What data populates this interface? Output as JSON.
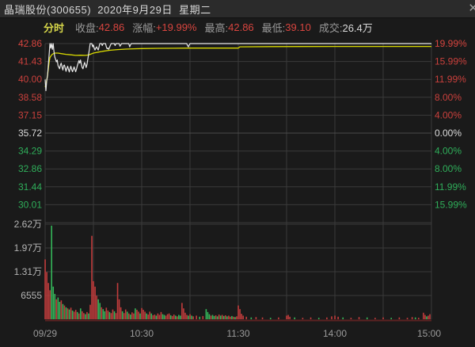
{
  "window": {
    "title": "晶瑞股份(300655)  2020年9月29日  星期二",
    "close_icon": "✕"
  },
  "info_bar": {
    "mode_label": "分时",
    "fields": [
      {
        "label": "收盘:",
        "value": "42.86",
        "value_color": "#d8453f"
      },
      {
        "label": "涨幅:",
        "value": "+19.99%",
        "value_color": "#d8453f"
      },
      {
        "label": "最高:",
        "value": "42.86",
        "value_color": "#d8453f"
      },
      {
        "label": "最低:",
        "value": "39.10",
        "value_color": "#d8453f"
      },
      {
        "label": "成交:",
        "value": "26.4万",
        "value_color": "#d9d9d9"
      }
    ]
  },
  "chart_data": {
    "type": "line",
    "title": "晶瑞股份(300655) 分时走势 2020-09-29",
    "x_axis": {
      "labels": [
        "09/29",
        "10:30",
        "11:30",
        "14:00",
        "15:00"
      ],
      "total_minutes": 240
    },
    "price_axis": {
      "ref_price": 35.72,
      "top_price": 42.86,
      "bottom_price": 28.58,
      "left_labels": [
        {
          "text": "42.86",
          "color": "#d8453f"
        },
        {
          "text": "41.43",
          "color": "#c9403c"
        },
        {
          "text": "40.00",
          "color": "#c9403c"
        },
        {
          "text": "38.58",
          "color": "#c9403c"
        },
        {
          "text": "37.15",
          "color": "#c9403c"
        },
        {
          "text": "35.72",
          "color": "#dcdcdc"
        },
        {
          "text": "34.29",
          "color": "#2fae5a"
        },
        {
          "text": "32.86",
          "color": "#2fae5a"
        },
        {
          "text": "31.44",
          "color": "#2fae5a"
        },
        {
          "text": "30.01",
          "color": "#2fae5a"
        }
      ],
      "right_labels": [
        {
          "text": "19.99%",
          "color": "#d8453f"
        },
        {
          "text": "15.99%",
          "color": "#c9403c"
        },
        {
          "text": "11.99%",
          "color": "#c9403c"
        },
        {
          "text": "8.00%",
          "color": "#c9403c"
        },
        {
          "text": "4.00%",
          "color": "#c9403c"
        },
        {
          "text": "0.00%",
          "color": "#dcdcdc"
        },
        {
          "text": "4.00%",
          "color": "#2fae5a"
        },
        {
          "text": "8.00%",
          "color": "#2fae5a"
        },
        {
          "text": "11.99%",
          "color": "#2fae5a"
        },
        {
          "text": "15.99%",
          "color": "#2fae5a"
        }
      ]
    },
    "volume_axis": {
      "labels": [
        "2.62万",
        "1.97万",
        "1.31万",
        "6555"
      ],
      "max_wan": 2.62,
      "label_color": "#b5b5b5"
    },
    "colors": {
      "price_line": "#eaeaea",
      "avg_line": "#d8d800",
      "vol_up": "#c23c3c",
      "vol_down": "#35b559",
      "grid": "#3a3a3a",
      "grid_zero": "#4a4a4a",
      "baseline": "#5c2222",
      "time_label": "#9a9a9a"
    },
    "series": [
      {
        "name": "price",
        "points": [
          [
            0,
            40.0
          ],
          [
            0.5,
            39.1
          ],
          [
            1,
            39.9
          ],
          [
            1.5,
            40.3
          ],
          [
            2,
            41.2
          ],
          [
            2.5,
            42.0
          ],
          [
            3,
            42.86
          ],
          [
            3.5,
            42.5
          ],
          [
            4,
            42.86
          ],
          [
            4.5,
            42.4
          ],
          [
            5,
            42.86
          ],
          [
            5.5,
            42.2
          ],
          [
            6,
            41.8
          ],
          [
            7,
            41.4
          ],
          [
            7.5,
            41.55
          ],
          [
            8,
            41.1
          ],
          [
            9,
            40.85
          ],
          [
            9.5,
            41.15
          ],
          [
            10,
            41.3
          ],
          [
            10.5,
            41.0
          ],
          [
            11,
            40.75
          ],
          [
            11.5,
            41.1
          ],
          [
            12,
            41.15
          ],
          [
            12.5,
            40.9
          ],
          [
            13,
            40.65
          ],
          [
            13.5,
            40.9
          ],
          [
            14,
            41.05
          ],
          [
            14.5,
            40.8
          ],
          [
            15,
            40.6
          ],
          [
            15.5,
            40.85
          ],
          [
            16,
            41.05
          ],
          [
            16.5,
            40.8
          ],
          [
            17,
            40.62
          ],
          [
            17.5,
            40.8
          ],
          [
            18,
            41.0
          ],
          [
            18.5,
            40.8
          ],
          [
            19,
            40.62
          ],
          [
            19.5,
            40.85
          ],
          [
            20,
            41.1
          ],
          [
            20.5,
            41.3
          ],
          [
            21,
            41.5
          ],
          [
            21.5,
            41.3
          ],
          [
            22,
            41.55
          ],
          [
            22.5,
            41.2
          ],
          [
            23,
            40.95
          ],
          [
            23.5,
            40.85
          ],
          [
            24,
            41.1
          ],
          [
            24.5,
            41.35
          ],
          [
            25,
            41.2
          ],
          [
            25.5,
            40.95
          ],
          [
            26,
            41.2
          ],
          [
            26.5,
            41.6
          ],
          [
            27,
            42.0
          ],
          [
            27.5,
            42.4
          ],
          [
            28,
            42.86
          ],
          [
            29,
            42.86
          ],
          [
            29.5,
            42.6
          ],
          [
            30,
            42.75
          ],
          [
            30.5,
            42.5
          ],
          [
            31,
            42.35
          ],
          [
            31.5,
            42.5
          ],
          [
            32,
            42.6
          ],
          [
            32.5,
            42.45
          ],
          [
            33,
            42.35
          ],
          [
            33.5,
            42.6
          ],
          [
            34,
            42.86
          ],
          [
            35,
            42.86
          ],
          [
            35.5,
            42.7
          ],
          [
            36,
            42.86
          ],
          [
            37.5,
            42.86
          ],
          [
            38,
            42.6
          ],
          [
            38.5,
            42.45
          ],
          [
            39,
            42.5
          ],
          [
            39.5,
            42.4
          ],
          [
            40,
            42.55
          ],
          [
            40.5,
            42.7
          ],
          [
            41,
            42.86
          ],
          [
            43,
            42.86
          ],
          [
            43.5,
            42.7
          ],
          [
            44,
            42.86
          ],
          [
            46,
            42.86
          ],
          [
            46.5,
            42.65
          ],
          [
            47,
            42.75
          ],
          [
            47.5,
            42.86
          ],
          [
            52,
            42.86
          ],
          [
            52.5,
            42.6
          ],
          [
            53,
            42.75
          ],
          [
            53.5,
            42.86
          ],
          [
            88,
            42.86
          ],
          [
            88.5,
            42.7
          ],
          [
            89,
            42.6
          ],
          [
            89.5,
            42.75
          ],
          [
            90,
            42.86
          ],
          [
            240,
            42.86
          ]
        ]
      },
      {
        "name": "average",
        "points": [
          [
            0,
            39.4
          ],
          [
            0.5,
            39.6
          ],
          [
            1,
            39.9
          ],
          [
            1.5,
            40.3
          ],
          [
            2,
            40.9
          ],
          [
            2.5,
            41.4
          ],
          [
            3,
            41.75
          ],
          [
            4,
            41.95
          ],
          [
            5,
            42.05
          ],
          [
            6,
            42.1
          ],
          [
            8,
            42.1
          ],
          [
            10,
            42.06
          ],
          [
            13,
            42.0
          ],
          [
            16,
            41.96
          ],
          [
            19,
            41.92
          ],
          [
            22,
            41.93
          ],
          [
            25,
            41.92
          ],
          [
            27,
            41.95
          ],
          [
            28,
            42.0
          ],
          [
            30,
            42.1
          ],
          [
            33,
            42.18
          ],
          [
            36,
            42.25
          ],
          [
            40,
            42.32
          ],
          [
            45,
            42.38
          ],
          [
            50,
            42.42
          ],
          [
            55,
            42.44
          ],
          [
            60,
            42.46
          ],
          [
            70,
            42.48
          ],
          [
            80,
            42.49
          ],
          [
            90,
            42.5
          ],
          [
            110,
            42.5
          ],
          [
            120,
            42.5
          ],
          [
            121,
            42.6
          ],
          [
            140,
            42.62
          ],
          [
            180,
            42.63
          ],
          [
            240,
            42.63
          ]
        ]
      }
    ],
    "volume_bars": [
      [
        0,
        1.65,
        "r"
      ],
      [
        1,
        1.3,
        "r"
      ],
      [
        2,
        1.0,
        "r"
      ],
      [
        3,
        0.8,
        "r"
      ],
      [
        4,
        2.58,
        "g"
      ],
      [
        5,
        0.9,
        "g"
      ],
      [
        6,
        0.7,
        "g"
      ],
      [
        7,
        0.55,
        "r"
      ],
      [
        8,
        0.6,
        "g"
      ],
      [
        9,
        0.48,
        "g"
      ],
      [
        10,
        0.52,
        "r"
      ],
      [
        11,
        0.42,
        "g"
      ],
      [
        12,
        0.38,
        "r"
      ],
      [
        13,
        0.33,
        "g"
      ],
      [
        14,
        0.3,
        "r"
      ],
      [
        15,
        0.27,
        "g"
      ],
      [
        16,
        0.32,
        "r"
      ],
      [
        17,
        0.24,
        "g"
      ],
      [
        18,
        0.21,
        "r"
      ],
      [
        19,
        0.26,
        "r"
      ],
      [
        20,
        0.2,
        "g"
      ],
      [
        21,
        0.16,
        "r"
      ],
      [
        22,
        0.3,
        "g"
      ],
      [
        23,
        0.22,
        "r"
      ],
      [
        24,
        0.17,
        "r"
      ],
      [
        25,
        0.14,
        "g"
      ],
      [
        26,
        0.2,
        "r"
      ],
      [
        27,
        0.16,
        "g"
      ],
      [
        28,
        0.4,
        "r"
      ],
      [
        29,
        2.3,
        "r"
      ],
      [
        30,
        1.05,
        "r"
      ],
      [
        31,
        0.9,
        "r"
      ],
      [
        32,
        0.65,
        "r"
      ],
      [
        33,
        0.55,
        "g"
      ],
      [
        34,
        0.45,
        "g"
      ],
      [
        35,
        0.33,
        "r"
      ],
      [
        36,
        0.28,
        "g"
      ],
      [
        37,
        0.22,
        "g"
      ],
      [
        38,
        0.32,
        "r"
      ],
      [
        39,
        0.24,
        "r"
      ],
      [
        40,
        0.2,
        "g"
      ],
      [
        41,
        0.17,
        "r"
      ],
      [
        42,
        0.27,
        "r"
      ],
      [
        43,
        0.22,
        "g"
      ],
      [
        44,
        0.17,
        "r"
      ],
      [
        45,
        1.0,
        "r"
      ],
      [
        46,
        0.55,
        "r"
      ],
      [
        47,
        0.33,
        "r"
      ],
      [
        48,
        0.22,
        "g"
      ],
      [
        49,
        0.17,
        "r"
      ],
      [
        50,
        0.27,
        "r"
      ],
      [
        51,
        0.21,
        "g"
      ],
      [
        52,
        0.16,
        "r"
      ],
      [
        53,
        0.13,
        "g"
      ],
      [
        54,
        0.19,
        "r"
      ],
      [
        55,
        0.16,
        "r"
      ],
      [
        56,
        0.3,
        "g"
      ],
      [
        57,
        0.26,
        "r"
      ],
      [
        58,
        0.21,
        "r"
      ],
      [
        59,
        0.16,
        "g"
      ],
      [
        60,
        0.31,
        "r"
      ],
      [
        61,
        0.26,
        "r"
      ],
      [
        62,
        0.21,
        "r"
      ],
      [
        63,
        0.16,
        "g"
      ],
      [
        64,
        0.13,
        "r"
      ],
      [
        65,
        0.21,
        "r"
      ],
      [
        66,
        0.16,
        "g"
      ],
      [
        67,
        0.11,
        "r"
      ],
      [
        68,
        0.13,
        "r"
      ],
      [
        69,
        0.1,
        "g"
      ],
      [
        70,
        0.16,
        "r"
      ],
      [
        71,
        0.12,
        "r"
      ],
      [
        72,
        0.2,
        "r"
      ],
      [
        73,
        0.14,
        "g"
      ],
      [
        74,
        0.12,
        "g"
      ],
      [
        75,
        0.1,
        "r"
      ],
      [
        76,
        0.14,
        "r"
      ],
      [
        77,
        0.16,
        "r"
      ],
      [
        78,
        0.11,
        "g"
      ],
      [
        79,
        0.09,
        "r"
      ],
      [
        80,
        0.13,
        "r"
      ],
      [
        81,
        0.1,
        "g"
      ],
      [
        82,
        0.08,
        "r"
      ],
      [
        83,
        0.12,
        "g"
      ],
      [
        84,
        0.1,
        "g"
      ],
      [
        85,
        0.45,
        "r"
      ],
      [
        86,
        0.3,
        "r"
      ],
      [
        87,
        0.18,
        "r"
      ],
      [
        88,
        0.12,
        "r"
      ],
      [
        89,
        0.1,
        "g"
      ],
      [
        90,
        0.14,
        "r"
      ],
      [
        91,
        0.1,
        "g"
      ],
      [
        92,
        0.08,
        "r"
      ],
      [
        94,
        0.1,
        "r"
      ],
      [
        96,
        0.07,
        "g"
      ],
      [
        98,
        0.09,
        "r"
      ],
      [
        100,
        0.28,
        "g"
      ],
      [
        101,
        0.2,
        "g"
      ],
      [
        102,
        0.14,
        "g"
      ],
      [
        103,
        0.1,
        "r"
      ],
      [
        104,
        0.12,
        "g"
      ],
      [
        105,
        0.09,
        "g"
      ],
      [
        106,
        0.11,
        "r"
      ],
      [
        107,
        0.08,
        "g"
      ],
      [
        108,
        0.13,
        "r"
      ],
      [
        109,
        0.1,
        "g"
      ],
      [
        110,
        0.12,
        "r"
      ],
      [
        111,
        0.09,
        "g"
      ],
      [
        112,
        0.11,
        "r"
      ],
      [
        113,
        0.08,
        "g"
      ],
      [
        114,
        0.1,
        "r"
      ],
      [
        115,
        0.07,
        "r"
      ],
      [
        116,
        0.09,
        "g"
      ],
      [
        117,
        0.07,
        "r"
      ],
      [
        118,
        0.06,
        "g"
      ],
      [
        119,
        0.08,
        "r"
      ],
      [
        120,
        0.38,
        "r"
      ],
      [
        121,
        0.28,
        "r"
      ],
      [
        122,
        0.15,
        "r"
      ],
      [
        123,
        0.1,
        "r"
      ],
      [
        125,
        0.07,
        "r"
      ],
      [
        128,
        0.05,
        "g"
      ],
      [
        131,
        0.06,
        "r"
      ],
      [
        135,
        0.05,
        "r"
      ],
      [
        140,
        0.04,
        "g"
      ],
      [
        145,
        0.05,
        "r"
      ],
      [
        150,
        0.1,
        "r"
      ],
      [
        151,
        0.12,
        "r"
      ],
      [
        152,
        0.07,
        "r"
      ],
      [
        155,
        0.05,
        "g"
      ],
      [
        160,
        0.04,
        "r"
      ],
      [
        165,
        0.05,
        "r"
      ],
      [
        170,
        0.04,
        "g"
      ],
      [
        175,
        0.05,
        "r"
      ],
      [
        178,
        0.08,
        "r"
      ],
      [
        180,
        0.1,
        "r"
      ],
      [
        182,
        0.07,
        "r"
      ],
      [
        185,
        0.05,
        "g"
      ],
      [
        190,
        0.04,
        "r"
      ],
      [
        195,
        0.06,
        "r"
      ],
      [
        200,
        0.05,
        "g"
      ],
      [
        205,
        0.04,
        "r"
      ],
      [
        210,
        0.05,
        "r"
      ],
      [
        215,
        0.04,
        "g"
      ],
      [
        220,
        0.05,
        "r"
      ],
      [
        225,
        0.04,
        "r"
      ],
      [
        228,
        0.06,
        "r"
      ],
      [
        230,
        0.05,
        "g"
      ],
      [
        232,
        0.04,
        "r"
      ],
      [
        235,
        0.18,
        "r"
      ],
      [
        236,
        0.12,
        "r"
      ],
      [
        237,
        0.08,
        "g"
      ],
      [
        238,
        0.1,
        "r"
      ],
      [
        239,
        0.14,
        "r"
      ]
    ]
  }
}
